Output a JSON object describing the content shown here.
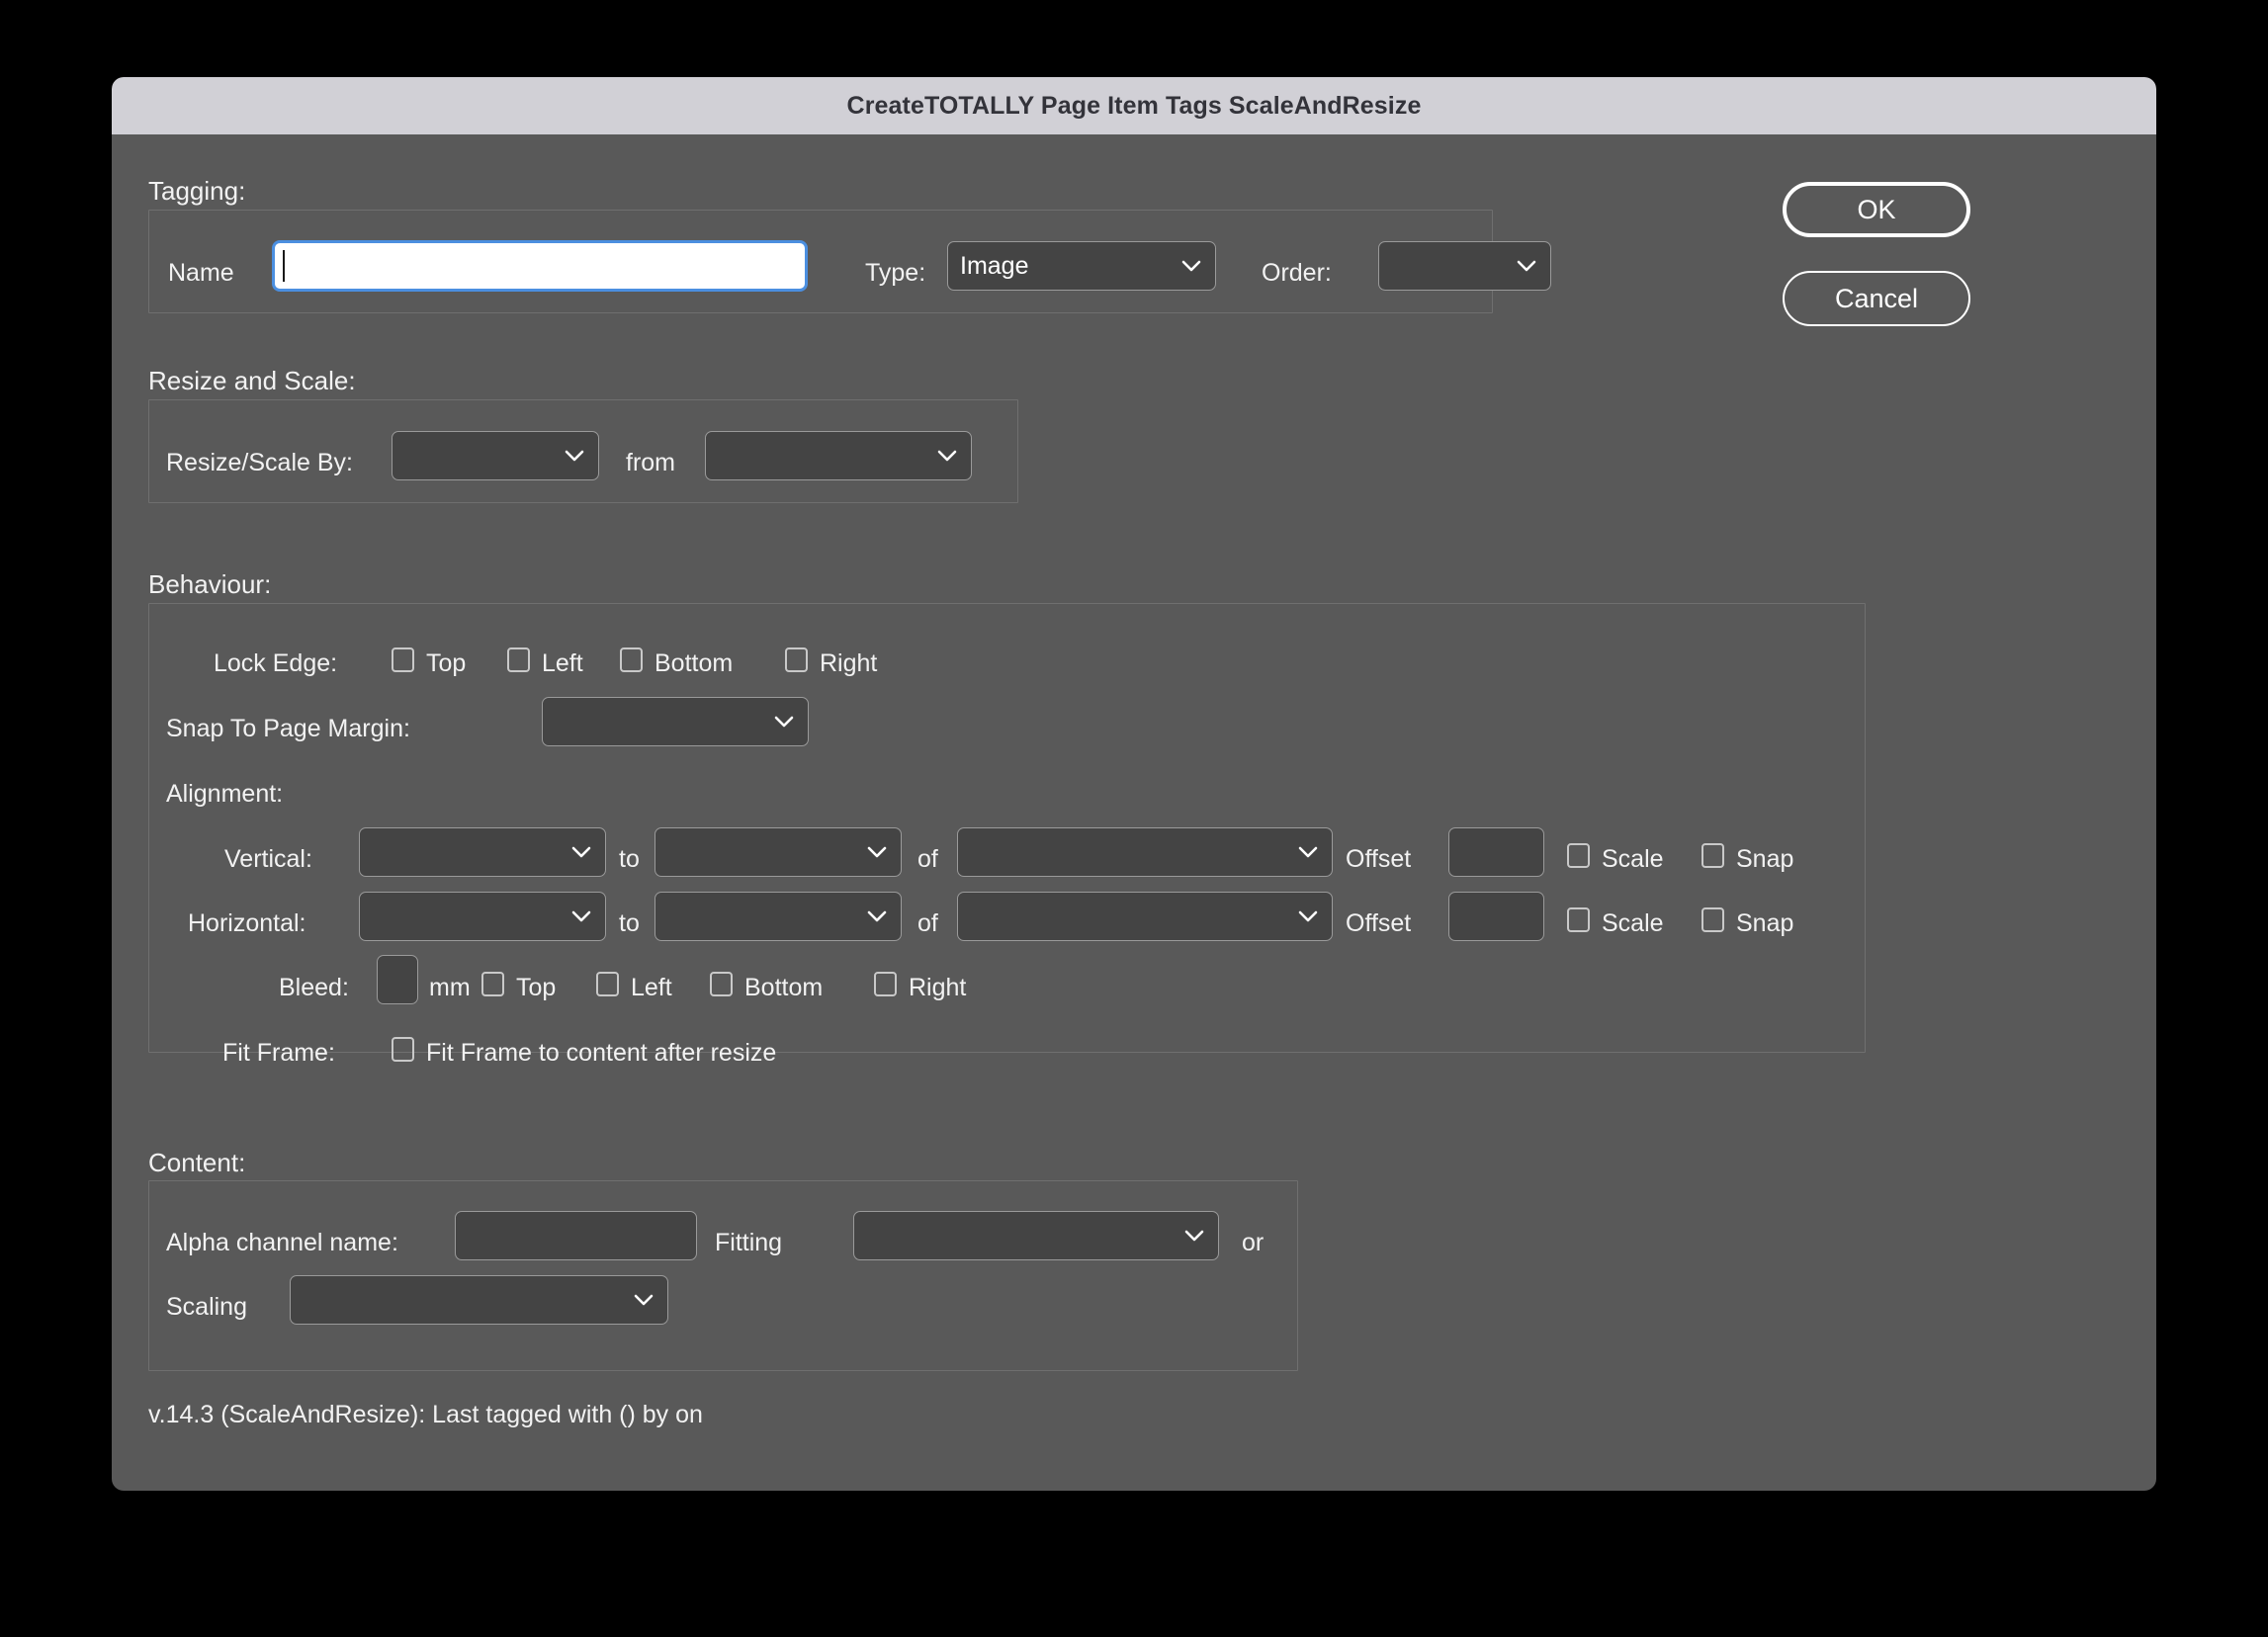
{
  "window": {
    "title": "CreateTOTALLY Page Item Tags ScaleAndResize"
  },
  "buttons": {
    "ok": "OK",
    "cancel": "Cancel"
  },
  "sections": {
    "tagging": "Tagging:",
    "resize_and_scale": "Resize and Scale:",
    "behaviour": "Behaviour:",
    "content": "Content:"
  },
  "tagging": {
    "name_label": "Name",
    "name_value": "",
    "type_label": "Type:",
    "type_value": "Image",
    "order_label": "Order:",
    "order_value": ""
  },
  "resize": {
    "resize_scale_by_label": "Resize/Scale By:",
    "resize_scale_by_value": "",
    "from_label": "from",
    "from_value": ""
  },
  "behaviour": {
    "lock_edge_label": "Lock Edge:",
    "lock_edges": [
      {
        "label": "Top",
        "checked": false
      },
      {
        "label": "Left",
        "checked": false
      },
      {
        "label": "Bottom",
        "checked": false
      },
      {
        "label": "Right",
        "checked": false
      }
    ],
    "snap_to_page_margin_label": "Snap To Page Margin:",
    "snap_to_page_margin_value": "",
    "alignment_label": "Alignment:",
    "vertical": {
      "label": "Vertical:",
      "align_value": "",
      "to_label": "to",
      "to_value": "",
      "of_label": "of",
      "of_value": "",
      "offset_label": "Offset",
      "offset_value": "",
      "scale_label": "Scale",
      "scale_checked": false,
      "snap_label": "Snap",
      "snap_checked": false
    },
    "horizontal": {
      "label": "Horizontal:",
      "align_value": "",
      "to_label": "to",
      "to_value": "",
      "of_label": "of",
      "of_value": "",
      "offset_label": "Offset",
      "offset_value": "",
      "scale_label": "Scale",
      "scale_checked": false,
      "snap_label": "Snap",
      "snap_checked": false
    },
    "bleed": {
      "label": "Bleed:",
      "value": "",
      "unit": "mm",
      "edges": [
        {
          "label": "Top",
          "checked": false
        },
        {
          "label": "Left",
          "checked": false
        },
        {
          "label": "Bottom",
          "checked": false
        },
        {
          "label": "Right",
          "checked": false
        }
      ]
    },
    "fit_frame": {
      "label": "Fit Frame:",
      "checkbox_label": "Fit Frame to content after resize",
      "checked": false
    }
  },
  "content": {
    "alpha_channel_label": "Alpha channel name:",
    "alpha_channel_value": "",
    "fitting_label": "Fitting",
    "fitting_value": "",
    "or_label": "or",
    "scaling_label": "Scaling",
    "scaling_value": ""
  },
  "footer": {
    "version_text": "v.14.3 (ScaleAndResize):  Last tagged with  ()  by   on"
  },
  "colors": {
    "dialog_background": "#595959",
    "titlebar_background": "#d1d0d6",
    "field_background": "#444444",
    "field_border": "#9a9a9a",
    "focus_border": "#4b8fe0",
    "text": "#f2f2f2"
  }
}
